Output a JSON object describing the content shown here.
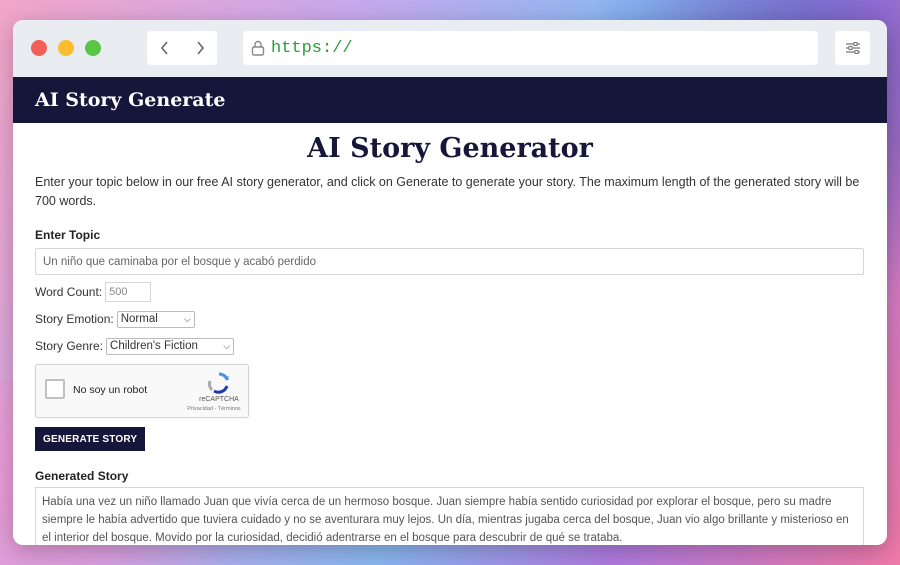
{
  "browser": {
    "url": "https://"
  },
  "site": {
    "title": "AI Story Generate"
  },
  "main": {
    "title": "AI Story Generator",
    "intro": "Enter your topic below in our free AI story generator, and click on Generate to generate your story. The maximum length of the generated story will be 700 words.",
    "topic_label": "Enter Topic",
    "topic_value": "Un niño que caminaba por el bosque y acabó perdido",
    "word_count_label": "Word Count:",
    "word_count_value": "500",
    "emotion_label": "Story Emotion:",
    "emotion_value": "Normal",
    "genre_label": "Story Genre:",
    "genre_value": "Children's Fiction",
    "generate_button": "GENERATE STORY",
    "generated_label": "Generated Story",
    "generated_text": "Había una vez un niño llamado Juan que vivía cerca de un hermoso bosque. Juan siempre había sentido curiosidad por explorar el bosque, pero su madre siempre le había advertido que tuviera cuidado y no se aventurara muy lejos. Un día, mientras jugaba cerca del bosque, Juan vio algo brillante y misterioso en el interior del bosque. Movido por la curiosidad, decidió adentrarse en el bosque para descubrir de qué se trataba."
  },
  "captcha": {
    "label": "No soy un robot",
    "brand": "reCAPTCHA",
    "links": "Privacidad - Términos"
  },
  "colors": {
    "header_bg": "#15163a",
    "url_green": "#2a9d3c"
  }
}
